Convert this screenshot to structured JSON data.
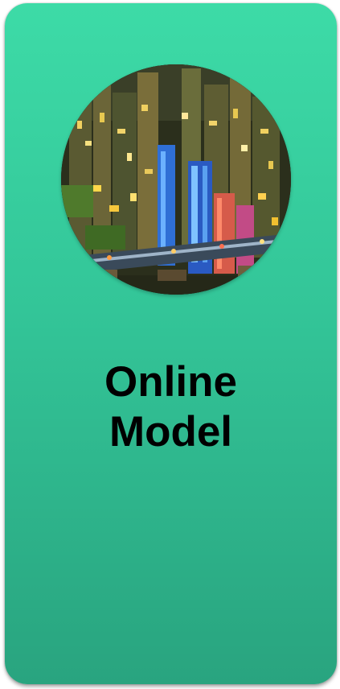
{
  "tile": {
    "title_line1": "Online",
    "title_line2": "Model",
    "image_icon": "city-night-skyline-image",
    "colors": {
      "gradient_top": "#3ddba7",
      "gradient_bottom": "#29a47f",
      "text": "#000000"
    }
  }
}
